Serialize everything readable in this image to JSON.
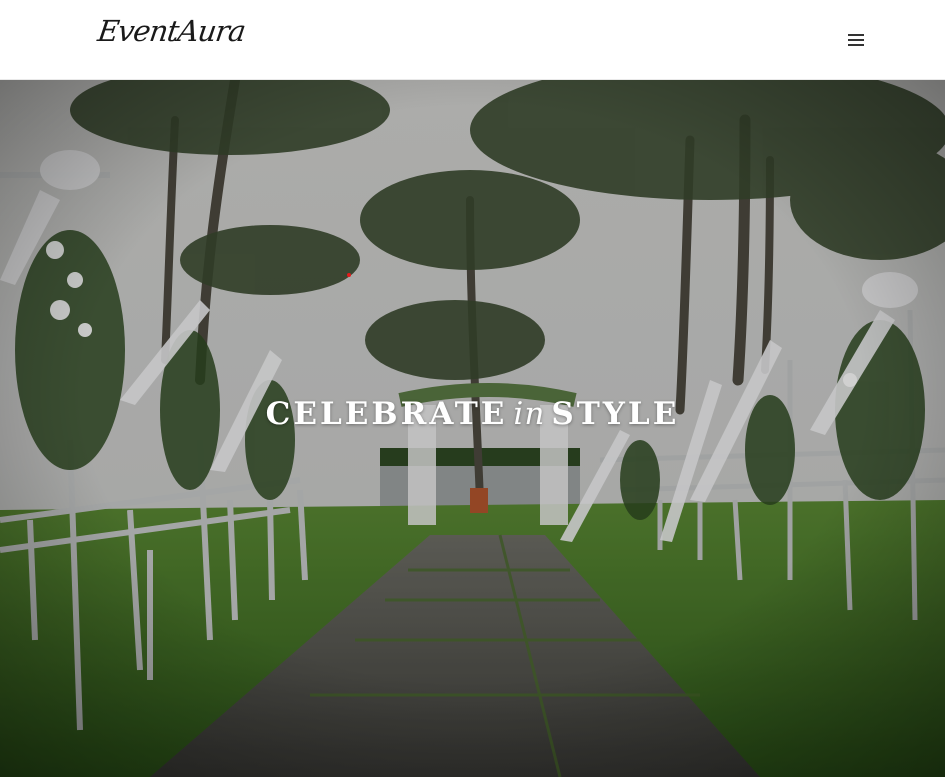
{
  "header": {
    "logo_text": "EventAura",
    "menu_icon": "hamburger-menu-icon"
  },
  "hero": {
    "title_part1": "CELEBRATE",
    "title_part2": "in",
    "title_part3": "STYLE"
  },
  "colors": {
    "header_bg": "#ffffff",
    "title_text": "#ffffff",
    "grass": "#4f7d2c",
    "sky": "#d8d8d8"
  }
}
